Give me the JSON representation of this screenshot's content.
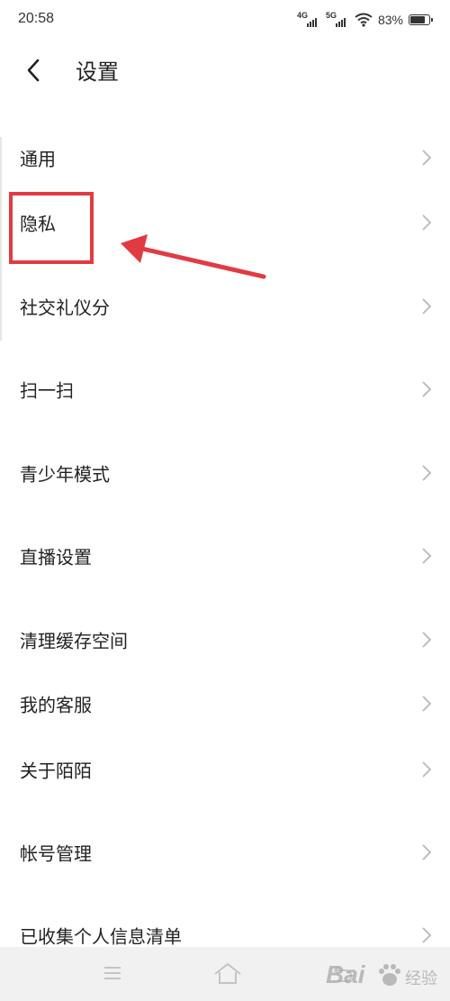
{
  "status_bar": {
    "time": "20:58",
    "network_1": "4G",
    "network_2": "5G",
    "battery_percent_text": "83%",
    "battery_level": 0.83
  },
  "header": {
    "title": "设置",
    "back_icon": "chevron-left-icon"
  },
  "menu": {
    "items": [
      {
        "label": "通用"
      },
      {
        "label": "隐私"
      },
      {
        "label": "社交礼仪分"
      },
      {
        "label": "扫一扫"
      },
      {
        "label": "青少年模式"
      },
      {
        "label": "直播设置"
      },
      {
        "label": "清理缓存空间"
      },
      {
        "label": "我的客服"
      },
      {
        "label": "关于陌陌"
      },
      {
        "label": "帐号管理"
      },
      {
        "label": "已收集个人信息清单"
      }
    ],
    "chevron_icon": "chevron-right-icon"
  },
  "annotation": {
    "highlighted_item": "隐私",
    "color": "#e23a43"
  },
  "nav_bar": {
    "icons": [
      "menu-icon",
      "home-icon",
      "back-icon"
    ]
  },
  "watermark": {
    "text": "Bai",
    "sub": "经验"
  }
}
